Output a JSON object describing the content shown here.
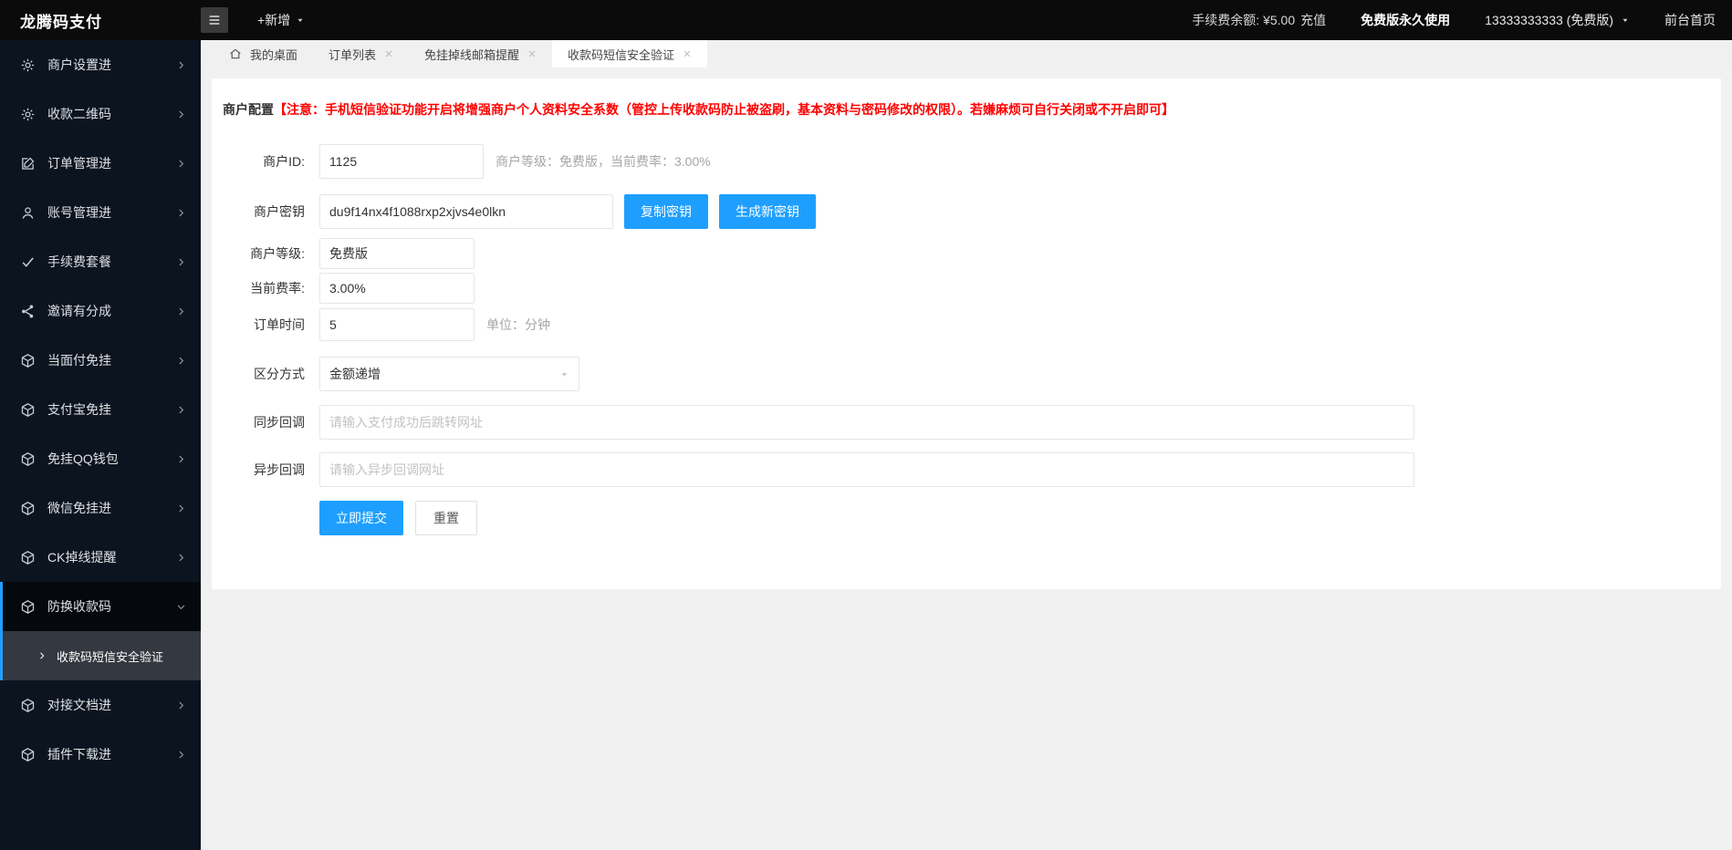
{
  "colors": {
    "accent": "#1E9FFF",
    "notice_red": "#FF0000",
    "sidebar_bg": "#0c141f",
    "topbar_bg": "#0b0b0b"
  },
  "topbar": {
    "logo": "龙腾码支付",
    "add_new": "+新增",
    "fee_balance_label": "手续费余额: ¥5.00",
    "recharge": "充值",
    "plan_badge": "免费版永久使用",
    "account": "13333333333 (免费版)",
    "front_home": "前台首页"
  },
  "sidebar": {
    "items": [
      {
        "label": "商户设置进",
        "icon": "gear-icon"
      },
      {
        "label": "收款二维码",
        "icon": "gear-icon"
      },
      {
        "label": "订单管理进",
        "icon": "edit-icon"
      },
      {
        "label": "账号管理进",
        "icon": "user-icon"
      },
      {
        "label": "手续费套餐",
        "icon": "check-icon"
      },
      {
        "label": "邀请有分成",
        "icon": "share-icon"
      },
      {
        "label": "当面付免挂",
        "icon": "cube-icon"
      },
      {
        "label": "支付宝免挂",
        "icon": "cube-icon"
      },
      {
        "label": "免挂QQ钱包",
        "icon": "cube-icon"
      },
      {
        "label": "微信免挂进",
        "icon": "cube-icon"
      },
      {
        "label": "CK掉线提醒",
        "icon": "cube-icon"
      },
      {
        "label": "防换收款码",
        "icon": "cube-icon",
        "expanded": true,
        "children": [
          {
            "label": "收款码短信安全验证",
            "active": true
          }
        ]
      },
      {
        "label": "对接文档进",
        "icon": "cube-icon"
      },
      {
        "label": "插件下载进",
        "icon": "cube-icon"
      }
    ]
  },
  "tabs": [
    {
      "label": "我的桌面",
      "icon": "home-icon",
      "closable": false,
      "active": false
    },
    {
      "label": "订单列表",
      "closable": true,
      "active": false
    },
    {
      "label": "免挂掉线邮箱提醒",
      "closable": true,
      "active": false
    },
    {
      "label": "收款码短信安全验证",
      "closable": true,
      "active": true
    }
  ],
  "page": {
    "notice_prefix": "商户配置",
    "notice_warning": "【注意：手机短信验证功能开启将增强商户个人资料安全系数（管控上传收款码防止被盗刷，基本资料与密码修改的权限）。若嫌麻烦可自行关闭或不开启即可】"
  },
  "form": {
    "merchant_id": {
      "label": "商户ID:",
      "value": "1125",
      "helper": "商户等级：免费版，当前费率：3.00%"
    },
    "merchant_key": {
      "label": "商户密钥",
      "value": "du9f14nx4f1088rxp2xjvs4e0lkn",
      "copy_label": "复制密钥",
      "generate_label": "生成新密钥"
    },
    "merchant_level": {
      "label": "商户等级:",
      "value": "免费版"
    },
    "current_rate": {
      "label": "当前费率:",
      "value": "3.00%"
    },
    "order_time": {
      "label": "订单时间",
      "value": "5",
      "unit": "单位：分钟"
    },
    "distinguish_mode": {
      "label": "区分方式",
      "value": "金额递增"
    },
    "sync_callback": {
      "label": "同步回调",
      "placeholder": "请输入支付成功后跳转网址"
    },
    "async_callback": {
      "label": "异步回调",
      "placeholder": "请输入异步回调网址"
    },
    "submit_label": "立即提交",
    "reset_label": "重置"
  }
}
